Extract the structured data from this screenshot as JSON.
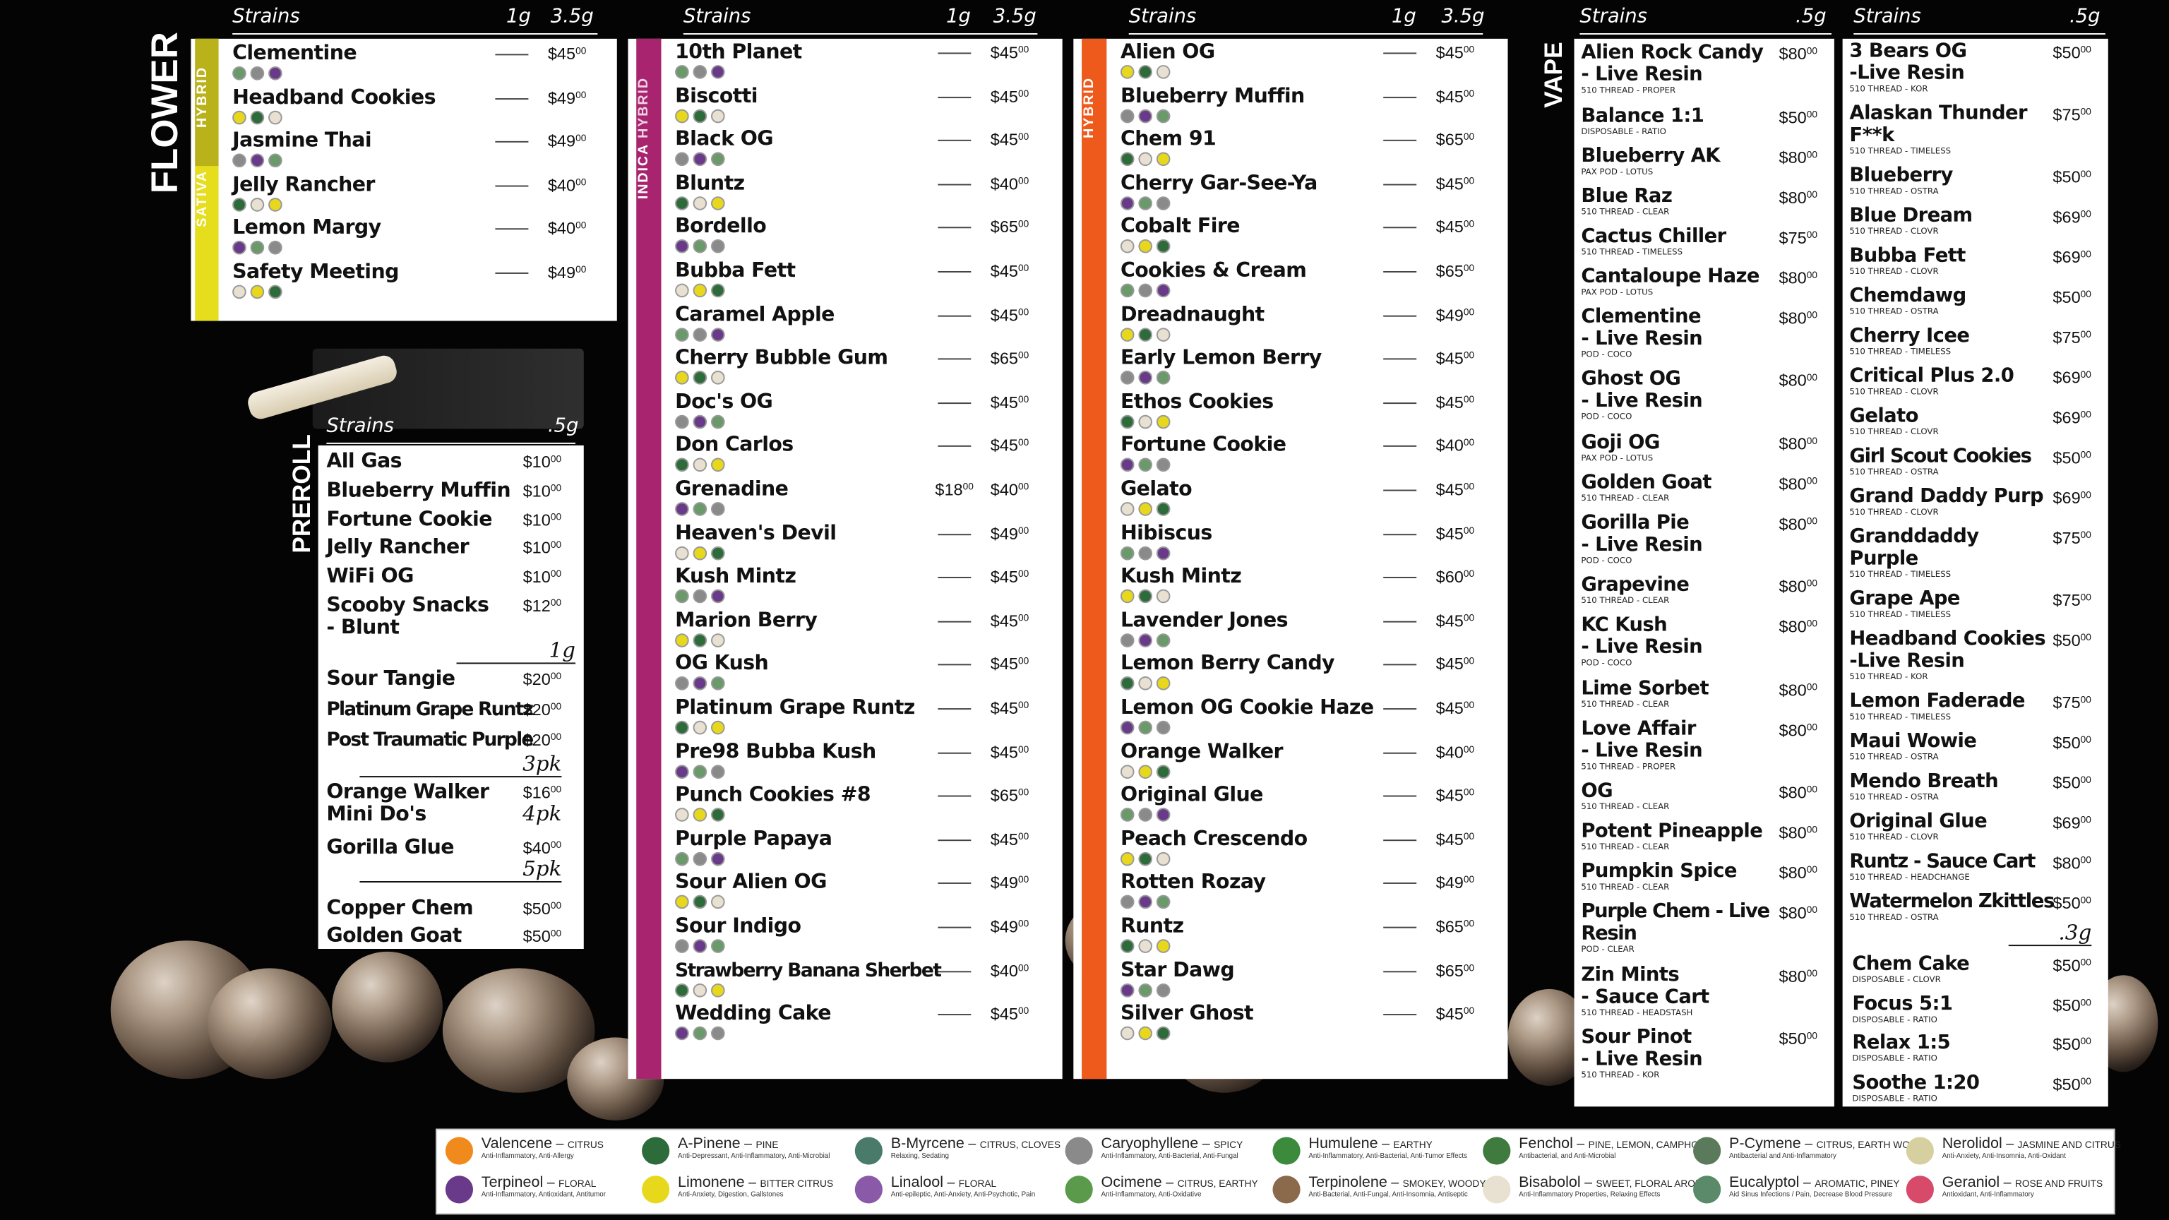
{
  "colors": {
    "sativa": "#e6dd1c",
    "indica": "#a8246f",
    "hybrid": "#ee5a1c",
    "panel": "#ffffff",
    "bg": "#040404"
  },
  "flower": {
    "title": "FLOWER",
    "band_sativa": "SATIVA",
    "band_hybrid": "HYBRID",
    "headers": {
      "strains": "Strains",
      "c1": "1g",
      "c2": "3.5g"
    },
    "items": [
      {
        "name": "Clementine",
        "p": "$45",
        "c": "00"
      },
      {
        "name": "Headband Cookies",
        "p": "$49",
        "c": "00"
      },
      {
        "name": "Jasmine Thai",
        "p": "$49",
        "c": "00"
      },
      {
        "name": "Jelly Rancher",
        "p": "$40",
        "c": "00"
      },
      {
        "name": "Lemon Margy",
        "p": "$40",
        "c": "00"
      },
      {
        "name": "Safety Meeting",
        "p": "$49",
        "c": "00"
      }
    ]
  },
  "indica": {
    "band_indica": "INDICA",
    "band_hybrid": "HYBRID",
    "headers": {
      "strains": "Strains",
      "c1": "1g",
      "c2": "3.5g"
    },
    "items": [
      {
        "name": "10th Planet",
        "p": "$45",
        "c": "00"
      },
      {
        "name": "Biscotti",
        "p": "$45",
        "c": "00"
      },
      {
        "name": "Black OG",
        "p": "$45",
        "c": "00"
      },
      {
        "name": "Bluntz",
        "p": "$40",
        "c": "00"
      },
      {
        "name": "Bordello",
        "p": "$65",
        "c": "00"
      },
      {
        "name": "Bubba Fett",
        "p": "$45",
        "c": "00"
      },
      {
        "name": "Caramel Apple",
        "p": "$45",
        "c": "00"
      },
      {
        "name": "Cherry Bubble Gum",
        "p": "$65",
        "c": "00"
      },
      {
        "name": "Doc's OG",
        "p": "$45",
        "c": "00"
      },
      {
        "name": "Don Carlos",
        "p": "$45",
        "c": "00"
      },
      {
        "name": "Grenadine",
        "p1": "$18",
        "c1": "00",
        "p": "$40",
        "c": "00"
      },
      {
        "name": "Heaven's Devil",
        "p": "$49",
        "c": "00"
      },
      {
        "name": "Kush Mintz",
        "p": "$45",
        "c": "00"
      },
      {
        "name": "Marion Berry",
        "p": "$45",
        "c": "00"
      },
      {
        "name": "OG Kush",
        "p": "$45",
        "c": "00"
      },
      {
        "name": "Platinum Grape Runtz",
        "p": "$45",
        "c": "00"
      },
      {
        "name": "Pre98 Bubba Kush",
        "p": "$45",
        "c": "00"
      },
      {
        "name": "Punch Cookies #8",
        "p": "$65",
        "c": "00"
      },
      {
        "name": "Purple Papaya",
        "p": "$45",
        "c": "00"
      },
      {
        "name": "Sour Alien OG",
        "p": "$49",
        "c": "00"
      },
      {
        "name": "Sour Indigo",
        "p": "$49",
        "c": "00"
      },
      {
        "name": "Strawberry Banana Sherbet",
        "p": "$40",
        "c": "00"
      },
      {
        "name": "Wedding Cake",
        "p": "$45",
        "c": "00"
      }
    ]
  },
  "hybrid": {
    "band": "HYBRID",
    "headers": {
      "strains": "Strains",
      "c1": "1g",
      "c2": "3.5g"
    },
    "items": [
      {
        "name": "Alien OG",
        "p": "$45",
        "c": "00"
      },
      {
        "name": "Blueberry Muffin",
        "p": "$45",
        "c": "00"
      },
      {
        "name": "Chem 91",
        "p": "$65",
        "c": "00"
      },
      {
        "name": "Cherry Gar-See-Ya",
        "p": "$45",
        "c": "00"
      },
      {
        "name": "Cobalt Fire",
        "p": "$45",
        "c": "00"
      },
      {
        "name": "Cookies & Cream",
        "p": "$65",
        "c": "00"
      },
      {
        "name": "Dreadnaught",
        "p": "$49",
        "c": "00"
      },
      {
        "name": "Early Lemon Berry",
        "p": "$45",
        "c": "00"
      },
      {
        "name": "Ethos Cookies",
        "p": "$45",
        "c": "00"
      },
      {
        "name": "Fortune Cookie",
        "p": "$40",
        "c": "00"
      },
      {
        "name": "Gelato",
        "p": "$45",
        "c": "00"
      },
      {
        "name": "Hibiscus",
        "p": "$45",
        "c": "00"
      },
      {
        "name": "Kush Mintz",
        "p": "$60",
        "c": "00"
      },
      {
        "name": "Lavender Jones",
        "p": "$45",
        "c": "00"
      },
      {
        "name": "Lemon Berry Candy",
        "p": "$45",
        "c": "00"
      },
      {
        "name": "Lemon OG Cookie Haze",
        "p": "$45",
        "c": "00"
      },
      {
        "name": "Orange Walker",
        "p": "$40",
        "c": "00"
      },
      {
        "name": "Original Glue",
        "p": "$45",
        "c": "00"
      },
      {
        "name": "Peach Crescendo",
        "p": "$45",
        "c": "00"
      },
      {
        "name": "Rotten Rozay",
        "p": "$49",
        "c": "00"
      },
      {
        "name": "Runtz",
        "p": "$65",
        "c": "00"
      },
      {
        "name": "Star Dawg",
        "p": "$65",
        "c": "00"
      },
      {
        "name": "Silver Ghost",
        "p": "$45",
        "c": "00"
      }
    ]
  },
  "preroll": {
    "title": "PREROLL",
    "headers": {
      "strains": "Strains",
      "c1": ".5g"
    },
    "items_a": [
      {
        "name": "All Gas",
        "p": "$10",
        "c": "00"
      },
      {
        "name": "Blueberry Muffin",
        "p": "$10",
        "c": "00"
      },
      {
        "name": "Fortune Cookie",
        "p": "$10",
        "c": "00"
      },
      {
        "name": "Jelly Rancher",
        "p": "$10",
        "c": "00"
      },
      {
        "name": "WiFi OG",
        "p": "$10",
        "c": "00"
      },
      {
        "name": "Scooby Snacks",
        "sub": "- Blunt",
        "p": "$12",
        "c": "00"
      }
    ],
    "label_1g": "1g",
    "items_b": [
      {
        "name": "Sour Tangie",
        "p": "$20",
        "c": "00"
      },
      {
        "name": "Platinum Grape Runtz",
        "p": "$20",
        "c": "00"
      },
      {
        "name": "Post Traumatic Purple",
        "p": "$20",
        "c": "00"
      }
    ],
    "label_3pk": "3pk",
    "item_c": {
      "name": "Orange Walker",
      "sub": "Mini Do's",
      "p": "$16",
      "c": "00"
    },
    "label_4pk": "4pk",
    "item_d": {
      "name": "Gorilla Glue",
      "p": "$40",
      "c": "00"
    },
    "label_5pk": "5pk",
    "items_e": [
      {
        "name": "Copper Chem",
        "p": "$50",
        "c": "00"
      },
      {
        "name": "Golden Goat",
        "p": "$50",
        "c": "00"
      }
    ]
  },
  "vape": {
    "title": "VAPE",
    "headers": {
      "strains": "Strains",
      "c1": ".5g"
    },
    "col1": [
      {
        "name": "Alien Rock Candy",
        "name2": "- Live Resin",
        "sub": "510 THREAD - PROPER",
        "p": "$80",
        "c": "00"
      },
      {
        "name": "Balance 1:1",
        "sub": "DISPOSABLE - RATIO",
        "p": "$50",
        "c": "00"
      },
      {
        "name": "Blueberry AK",
        "sub": "PAX POD - LOTUS",
        "p": "$80",
        "c": "00"
      },
      {
        "name": "Blue Raz",
        "sub": "510 THREAD - CLEAR",
        "p": "$80",
        "c": "00"
      },
      {
        "name": "Cactus Chiller",
        "sub": "510 THREAD - TIMELESS",
        "p": "$75",
        "c": "00"
      },
      {
        "name": "Cantaloupe Haze",
        "sub": "PAX POD - LOTUS",
        "p": "$80",
        "c": "00"
      },
      {
        "name": "Clementine",
        "name2": "- Live Resin",
        "sub": "POD - COCO",
        "p": "$80",
        "c": "00"
      },
      {
        "name": "Ghost OG",
        "name2": "- Live Resin",
        "sub": "POD - COCO",
        "p": "$80",
        "c": "00"
      },
      {
        "name": "Goji OG",
        "sub": "PAX POD - LOTUS",
        "p": "$80",
        "c": "00"
      },
      {
        "name": "Golden Goat",
        "sub": "510 THREAD - CLEAR",
        "p": "$80",
        "c": "00"
      },
      {
        "name": "Gorilla Pie",
        "name2": "- Live Resin",
        "sub": "POD - COCO",
        "p": "$80",
        "c": "00"
      },
      {
        "name": "Grapevine",
        "sub": "510 THREAD - CLEAR",
        "p": "$80",
        "c": "00"
      },
      {
        "name": "KC Kush",
        "name2": "- Live Resin",
        "sub": "POD - COCO",
        "p": "$80",
        "c": "00"
      },
      {
        "name": "Lime Sorbet",
        "sub": "510 THREAD - CLEAR",
        "p": "$80",
        "c": "00"
      },
      {
        "name": "Love Affair",
        "name2": "- Live Resin",
        "sub": "510 THREAD - PROPER",
        "p": "$80",
        "c": "00"
      },
      {
        "name": "OG",
        "sub": "510 THREAD - CLEAR",
        "p": "$80",
        "c": "00"
      },
      {
        "name": "Potent Pineapple",
        "sub": "510 THREAD - CLEAR",
        "p": "$80",
        "c": "00"
      },
      {
        "name": "Pumpkin Spice",
        "sub": "510 THREAD - CLEAR",
        "p": "$80",
        "c": "00"
      },
      {
        "name": "Purple Chem - Live",
        "name2": "Resin",
        "sub": "POD - CLEAR",
        "p": "$80",
        "c": "00"
      },
      {
        "name": "Zin Mints",
        "name2": "- Sauce Cart",
        "sub": "510 THREAD - HEADSTASH",
        "p": "$80",
        "c": "00"
      },
      {
        "name": "Sour Pinot",
        "name2": "- Live Resin",
        "sub": "510 THREAD - KOR",
        "p": "$50",
        "c": "00"
      }
    ],
    "col2": [
      {
        "name": "3 Bears OG",
        "name2": "-Live Resin",
        "sub": "510 THREAD - KOR",
        "p": "$50",
        "c": "00"
      },
      {
        "name": "Alaskan Thunder",
        "name2": "F**k",
        "sub": "510 THREAD - TIMELESS",
        "p": "$75",
        "c": "00"
      },
      {
        "name": "Blueberry",
        "sub": "510 THREAD - OSTRA",
        "p": "$50",
        "c": "00"
      },
      {
        "name": "Blue Dream",
        "sub": "510 THREAD - CLOVR",
        "p": "$69",
        "c": "00"
      },
      {
        "name": "Bubba Fett",
        "sub": "510 THREAD - CLOVR",
        "p": "$69",
        "c": "00"
      },
      {
        "name": "Chemdawg",
        "sub": "510 THREAD - OSTRA",
        "p": "$50",
        "c": "00"
      },
      {
        "name": "Cherry Icee",
        "sub": "510 THREAD - TIMELESS",
        "p": "$75",
        "c": "00"
      },
      {
        "name": "Critical Plus 2.0",
        "sub": "510 THREAD - CLOVR",
        "p": "$69",
        "c": "00"
      },
      {
        "name": "Gelato",
        "sub": "510 THREAD - CLOVR",
        "p": "$69",
        "c": "00"
      },
      {
        "name": "Girl Scout Cookies",
        "sub": "510 THREAD - OSTRA",
        "p": "$50",
        "c": "00"
      },
      {
        "name": "Grand Daddy Purp",
        "sub": "510 THREAD - CLOVR",
        "p": "$69",
        "c": "00"
      },
      {
        "name": "Granddaddy",
        "name2": "Purple",
        "sub": "510 THREAD - TIMELESS",
        "p": "$75",
        "c": "00"
      },
      {
        "name": "Grape Ape",
        "sub": "510 THREAD - TIMELESS",
        "p": "$75",
        "c": "00"
      },
      {
        "name": "Headband Cookies",
        "name2": "-Live Resin",
        "sub": "510 THREAD - KOR",
        "p": "$50",
        "c": "00"
      },
      {
        "name": "Lemon Faderade",
        "sub": "510 THREAD - TIMELESS",
        "p": "$75",
        "c": "00"
      },
      {
        "name": "Maui Wowie",
        "sub": "510 THREAD - OSTRA",
        "p": "$50",
        "c": "00"
      },
      {
        "name": "Mendo Breath",
        "sub": "510 THREAD - OSTRA",
        "p": "$50",
        "c": "00"
      },
      {
        "name": "Original Glue",
        "sub": "510 THREAD - CLOVR",
        "p": "$69",
        "c": "00"
      },
      {
        "name": "Runtz - Sauce Cart",
        "sub": "510 THREAD - HEADCHANGE",
        "p": "$80",
        "c": "00"
      },
      {
        "name": "Watermelon Zkittles",
        "sub": "510 THREAD - OSTRA",
        "p": "$50",
        "c": "00"
      }
    ],
    "label_3g": ".3g",
    "col2b": [
      {
        "name": "Chem Cake",
        "sub": "DISPOSABLE - CLOVR",
        "p": "$50",
        "c": "00"
      },
      {
        "name": "Focus 5:1",
        "sub": "DISPOSABLE - RATIO",
        "p": "$50",
        "c": "00"
      },
      {
        "name": "Relax 1:5",
        "sub": "DISPOSABLE - RATIO",
        "p": "$50",
        "c": "00"
      },
      {
        "name": "Soothe 1:20",
        "sub": "DISPOSABLE - RATIO",
        "p": "$50",
        "c": "00"
      }
    ]
  },
  "legend": [
    {
      "name": "Valencene",
      "desc": "CITRUS",
      "eff": "Anti-Inflammatory, Anti-Allergy",
      "color": "#f08a1c",
      "icon": "orange-icon"
    },
    {
      "name": "A-Pinene",
      "desc": "PINE",
      "eff": "Anti-Depressant, Anti-Inflammatory, Anti-Microbial",
      "color": "#2e6b3a",
      "icon": "pine-tree-icon"
    },
    {
      "name": "B-Myrcene",
      "desc": "CITRUS, CLOVES",
      "eff": "Relaxing, Sedating",
      "color": "#4a7a6a",
      "icon": "hops-icon"
    },
    {
      "name": "Caryophyllene",
      "desc": "SPICY",
      "eff": "Anti-Inflammatory, Anti-Bacterial, Anti-Fungal",
      "color": "#8a8a8a",
      "icon": "peppercorn-icon"
    },
    {
      "name": "Humulene",
      "desc": "EARTHY",
      "eff": "Anti-Inflammatory, Anti-Bacterial, Anti-Tumor Effects",
      "color": "#3c8a3c",
      "icon": "humulus-icon"
    },
    {
      "name": "Fenchol",
      "desc": "PINE, LEMON, CAMPHOR",
      "eff": "Antibacterial, and Anti-Microbial",
      "color": "#3f7a3f",
      "icon": "leaf-icon"
    },
    {
      "name": "P-Cymene",
      "desc": "CITRUS, EARTH WOOD",
      "eff": "Antibacterial and Anti-Inflammatory",
      "color": "#5b7a5b",
      "icon": "herb-icon"
    },
    {
      "name": "Nerolidol",
      "desc": "JASMINE AND CITRUS",
      "eff": "Anti-Anxiety, Anti-Insomnia, Anti-Oxidant",
      "color": "#d6cfa0",
      "icon": "jasmine-icon"
    },
    {
      "name": "Terpineol",
      "desc": "FLORAL",
      "eff": "Anti-Inflammatory, Antioxidant, Antitumor",
      "color": "#6a3a8a",
      "icon": "lilac-icon"
    },
    {
      "name": "Limonene",
      "desc": "BITTER CITRUS",
      "eff": "Anti-Anxiety, Digestion, Gallstones",
      "color": "#e8d81c",
      "icon": "lemon-icon"
    },
    {
      "name": "Linalool",
      "desc": "FLORAL",
      "eff": "Anti-epileptic, Anti-Anxiety, Anti-Psychotic, Pain",
      "color": "#8a5aa8",
      "icon": "lavender-icon"
    },
    {
      "name": "Ocimene",
      "desc": "CITRUS, EARTHY",
      "eff": "Anti-Inflammatory, Anti-Oxidative",
      "color": "#5a9a4a",
      "icon": "basil-icon"
    },
    {
      "name": "Terpinolene",
      "desc": "SMOKEY, WOODY",
      "eff": "Anti-Bacterial, Anti-Fungal, Anti-Insomnia, Antiseptic",
      "color": "#8a6a4a",
      "icon": "wood-icon"
    },
    {
      "name": "Bisabolol",
      "desc": "SWEET, FLORAL AROMA",
      "eff": "Anti-Inflammatory Properties, Relaxing Effects",
      "color": "#e8e0d0",
      "icon": "chamomile-icon"
    },
    {
      "name": "Eucalyptol",
      "desc": "AROMATIC, PINEY",
      "eff": "Aid Sinus Infections / Pain, Decrease Blood Pressure",
      "color": "#5a8a6a",
      "icon": "eucalyptus-icon"
    },
    {
      "name": "Geraniol",
      "desc": "ROSE AND FRUITS",
      "eff": "Antioxidant, Anti-Inflammatory",
      "color": "#d84a6a",
      "icon": "rose-icon"
    }
  ]
}
